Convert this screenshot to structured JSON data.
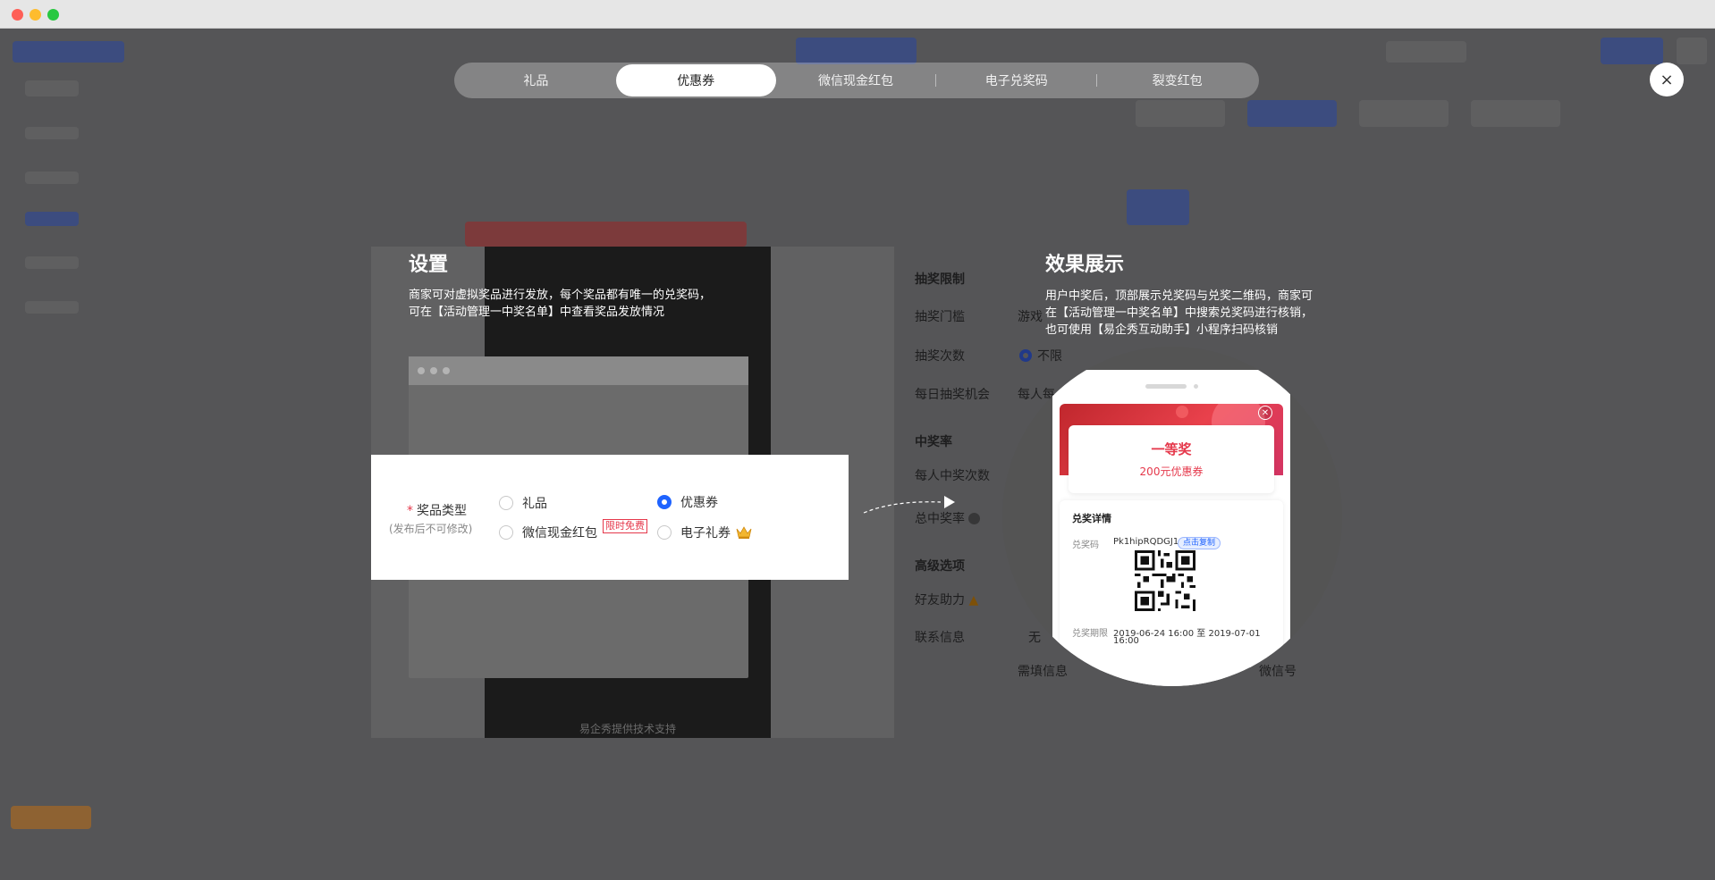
{
  "tabs": [
    {
      "label": "礼品",
      "active": false
    },
    {
      "label": "优惠券",
      "active": true
    },
    {
      "label": "微信现金红包",
      "active": false
    },
    {
      "label": "电子兑奖码",
      "active": false
    },
    {
      "label": "裂变红包",
      "active": false
    }
  ],
  "close_label": "×",
  "settings": {
    "title": "设置",
    "desc_line1": "商家可对虚拟奖品进行发放，每个奖品都有唯一的兑奖码，",
    "desc_line2": "可在【活动管理一中奖名单】中查看奖品发放情况"
  },
  "prize_type": {
    "label": "奖品类型",
    "required_mark": "*",
    "hint": "(发布后不可修改)",
    "options": [
      {
        "label": "礼品",
        "checked": false
      },
      {
        "label": "优惠券",
        "checked": true
      },
      {
        "label": "微信现金红包",
        "checked": false,
        "badge": "限时免费"
      },
      {
        "label": "电子礼券",
        "checked": false,
        "icon": "crown-icon"
      }
    ]
  },
  "background_form": {
    "labels": [
      "抽奖限制",
      "抽奖门槛",
      "抽奖次数",
      "每日抽奖机会",
      "中奖率",
      "每人中奖次数",
      "总中奖率",
      "高级选项",
      "好友助力",
      "联系信息",
      "需填信息"
    ],
    "values": [
      "游戏",
      "不限",
      "每人每",
      "无",
      "微信号"
    ],
    "phone_footer": "易企秀提供技术支持"
  },
  "effect": {
    "title": "效果展示",
    "desc_line1": "用户中奖后，顶部展示兑奖码与兑奖二维码，商家可",
    "desc_line2": "在【活动管理一中奖名单】中搜索兑奖码进行核销，",
    "desc_line3": "也可使用【易企秀互动助手】小程序扫码核销"
  },
  "phone_preview": {
    "prize_title": "一等奖",
    "prize_sub": "200元优惠券",
    "detail_title": "兑奖详情",
    "code_label": "兑奖码",
    "code_value": "Pk1hipRQDGJ1",
    "copy_label": "点击复制",
    "period_label": "兑奖期限",
    "period_value_line1": "2019-06-24 16:00 至 2019-07-01",
    "period_value_line2": "16:00"
  },
  "colors": {
    "accent_blue": "#1e63ff",
    "accent_red": "#e5384b"
  }
}
